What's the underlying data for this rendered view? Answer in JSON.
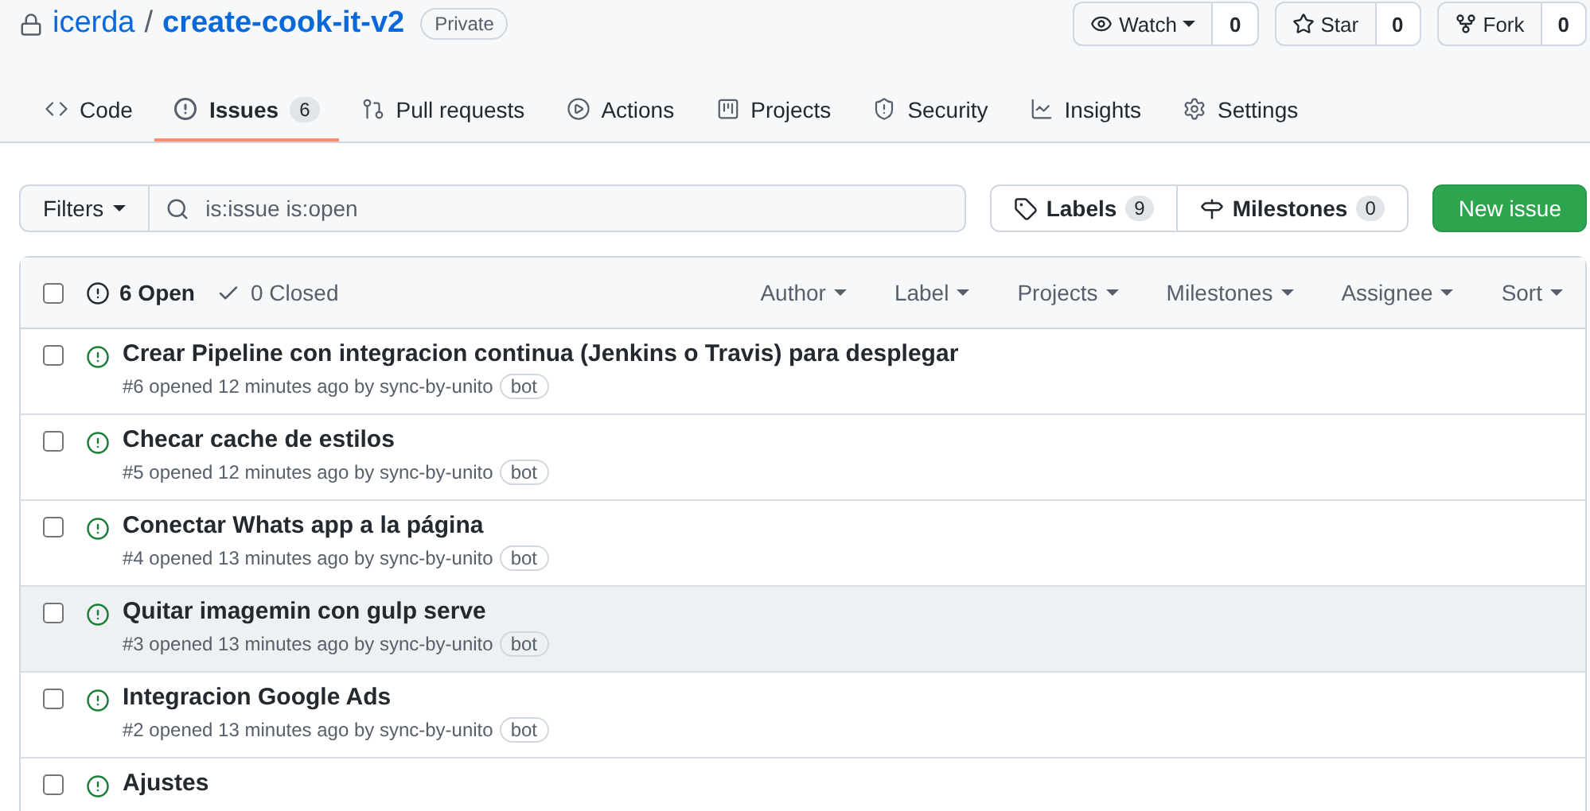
{
  "repo": {
    "owner": "icerda",
    "separator": "/",
    "name": "create-cook-it-v2",
    "visibility": "Private"
  },
  "repo_actions": [
    {
      "kind": "watch",
      "label": "Watch",
      "count": "0"
    },
    {
      "kind": "star",
      "label": "Star",
      "count": "0"
    },
    {
      "kind": "fork",
      "label": "Fork",
      "count": "0"
    }
  ],
  "tabs": [
    {
      "kind": "code",
      "label": "Code",
      "selected": false
    },
    {
      "kind": "issues",
      "label": "Issues",
      "count": "6",
      "selected": true
    },
    {
      "kind": "pulls",
      "label": "Pull requests",
      "selected": false
    },
    {
      "kind": "actions",
      "label": "Actions",
      "selected": false
    },
    {
      "kind": "projects",
      "label": "Projects",
      "selected": false
    },
    {
      "kind": "security",
      "label": "Security",
      "selected": false
    },
    {
      "kind": "insights",
      "label": "Insights",
      "selected": false
    },
    {
      "kind": "settings",
      "label": "Settings",
      "selected": false
    }
  ],
  "filters_button": "Filters",
  "search": {
    "value": "is:issue is:open"
  },
  "labels": {
    "label": "Labels",
    "count": "9"
  },
  "milestones": {
    "label": "Milestones",
    "count": "0"
  },
  "new_issue": "New issue",
  "list_header": {
    "checked": false,
    "states": [
      {
        "kind": "open",
        "label": "6 Open",
        "selected": true
      },
      {
        "kind": "closed",
        "label": "0 Closed",
        "selected": false
      }
    ],
    "filters": [
      "Author",
      "Label",
      "Projects",
      "Milestones",
      "Assignee",
      "Sort"
    ]
  },
  "issues": [
    {
      "title": "Crear Pipeline con integracion continua (Jenkins o Travis) para desplegar",
      "meta": "#6 opened 12 minutes ago by sync-by-unito",
      "badge": "bot",
      "checked": false,
      "highlighted": false
    },
    {
      "title": "Checar cache de estilos",
      "meta": "#5 opened 12 minutes ago by sync-by-unito",
      "badge": "bot",
      "checked": false,
      "highlighted": false
    },
    {
      "title": "Conectar Whats app a la página",
      "meta": "#4 opened 13 minutes ago by sync-by-unito",
      "badge": "bot",
      "checked": false,
      "highlighted": false
    },
    {
      "title": "Quitar imagemin con gulp serve",
      "meta": "#3 opened 13 minutes ago by sync-by-unito",
      "badge": "bot",
      "checked": false,
      "highlighted": true
    },
    {
      "title": "Integracion Google Ads",
      "meta": "#2 opened 13 minutes ago by sync-by-unito",
      "badge": "bot",
      "checked": false,
      "highlighted": false
    },
    {
      "title": "Ajustes",
      "checked": false,
      "highlighted": false
    }
  ]
}
